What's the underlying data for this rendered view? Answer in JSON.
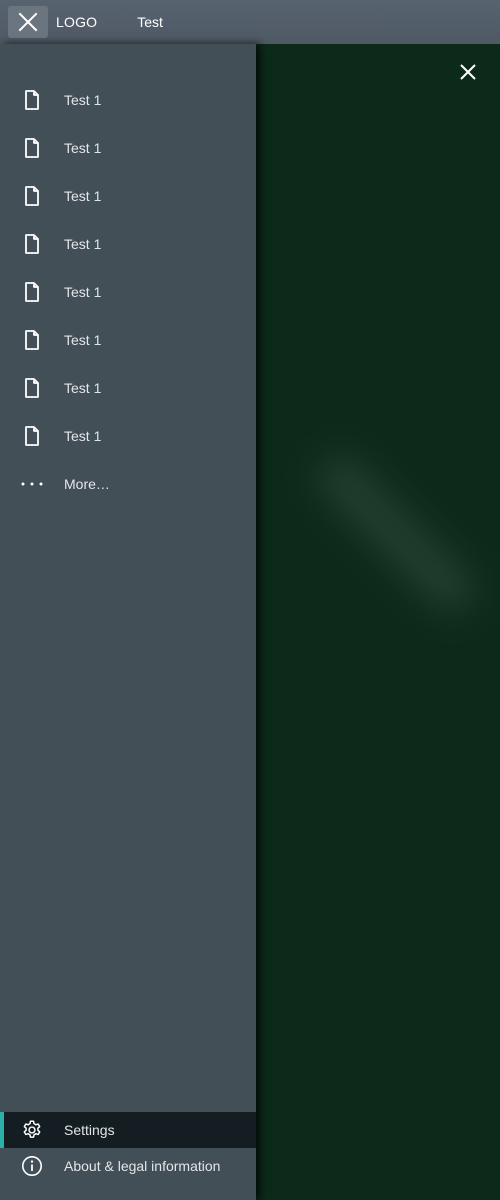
{
  "header": {
    "logo": "LOGO",
    "title": "Test"
  },
  "drawer": {
    "items": [
      {
        "label": "Test 1",
        "icon": "document-icon"
      },
      {
        "label": "Test 1",
        "icon": "document-icon"
      },
      {
        "label": "Test 1",
        "icon": "document-icon"
      },
      {
        "label": "Test 1",
        "icon": "document-icon"
      },
      {
        "label": "Test 1",
        "icon": "document-icon"
      },
      {
        "label": "Test 1",
        "icon": "document-icon"
      },
      {
        "label": "Test 1",
        "icon": "document-icon"
      },
      {
        "label": "Test 1",
        "icon": "document-icon"
      }
    ],
    "more": {
      "label": "More…",
      "icon": "more-dots-icon"
    },
    "bottom": {
      "settings": {
        "label": "Settings",
        "icon": "gear-icon",
        "active": true
      },
      "about": {
        "label": "About & legal information",
        "icon": "info-icon"
      }
    }
  },
  "colors": {
    "header_bg": "#55606b",
    "drawer_bg": "#424f57",
    "content_bg": "#0c2a1a",
    "active_bg": "#141d22",
    "accent": "#2bb1a8"
  }
}
